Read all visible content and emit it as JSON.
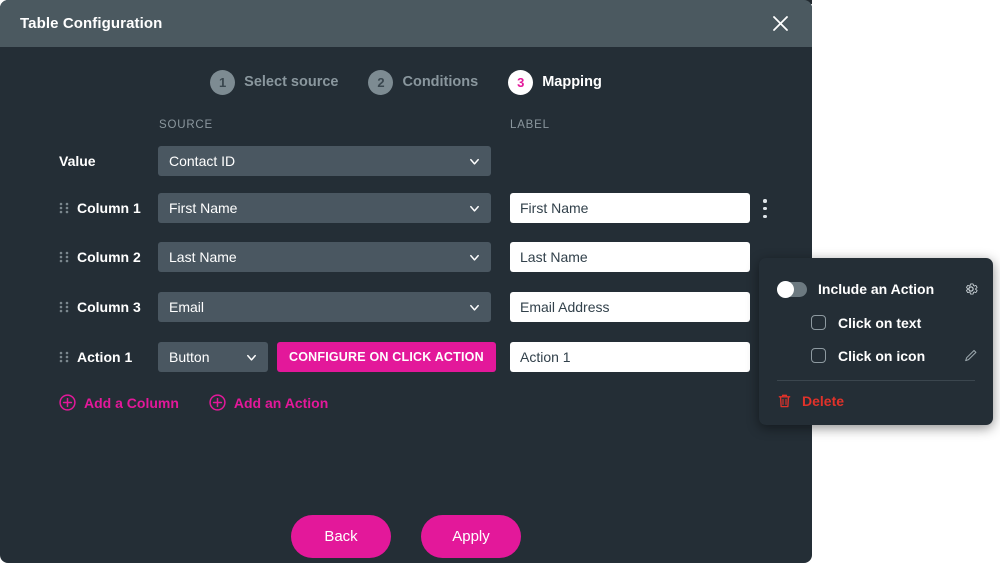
{
  "modal": {
    "title": "Table Configuration",
    "close_icon": "close-icon"
  },
  "stepper": {
    "steps": [
      {
        "number": "1",
        "label": "Select source",
        "active": false
      },
      {
        "number": "2",
        "label": "Conditions",
        "active": false
      },
      {
        "number": "3",
        "label": "Mapping",
        "active": true
      }
    ]
  },
  "columns_header": {
    "source": "SOURCE",
    "label": "LABEL"
  },
  "rows": [
    {
      "name": "Value",
      "draggable": false,
      "source": "Contact ID",
      "has_label_input": false,
      "has_kebab": false
    },
    {
      "name": "Column 1",
      "draggable": true,
      "source": "First Name",
      "has_label_input": true,
      "label_value": "First Name",
      "has_kebab": true
    },
    {
      "name": "Column 2",
      "draggable": true,
      "source": "Last Name",
      "has_label_input": true,
      "label_value": "Last Name",
      "has_kebab": false
    },
    {
      "name": "Column 3",
      "draggable": true,
      "source": "Email",
      "has_label_input": true,
      "label_value": "Email Address",
      "has_kebab": false
    },
    {
      "name": "Action 1",
      "draggable": true,
      "source": "Button",
      "configure_button": "CONFIGURE ON CLICK ACTION",
      "has_label_input": true,
      "label_value": "Action 1",
      "has_kebab": false
    }
  ],
  "add_links": [
    {
      "label": "Add a Column",
      "icon": "plus-circle-icon"
    },
    {
      "label": "Add an Action",
      "icon": "plus-circle-icon"
    }
  ],
  "footer": {
    "back": "Back",
    "apply": "Apply"
  },
  "popup": {
    "toggle_label": "Include an Action",
    "toggle_state": "off",
    "gear_icon": "gear-icon",
    "pencil_icon": "pencil-icon",
    "checkboxes": [
      {
        "label": "Click on text",
        "checked": false,
        "has_edit": false
      },
      {
        "label": "Click on icon",
        "checked": false,
        "has_edit": true
      }
    ],
    "delete": "Delete",
    "delete_icon": "trash-icon"
  },
  "colors": {
    "accent": "#e3189a",
    "modal_bg": "#242e36",
    "titlebar_bg": "#4b5960",
    "select_bg": "#4a5761",
    "danger": "#e0322a"
  }
}
